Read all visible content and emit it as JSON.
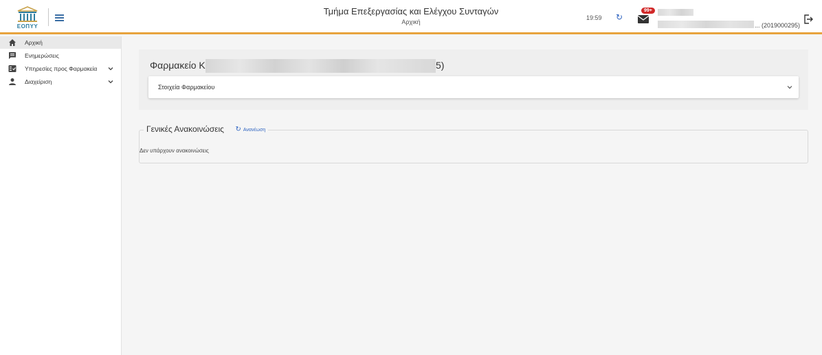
{
  "header": {
    "logo_text": "ΕΟΠΥΥ",
    "title": "Τμήμα Επεξεργασίας και Ελέγχου Συνταγών",
    "subtitle": "Αρχική",
    "time": "19:59",
    "badge": "99+",
    "user_id": "... (2019000295)"
  },
  "sidebar": {
    "items": [
      {
        "label": "Αρχική",
        "icon": "home-icon"
      },
      {
        "label": "Ενημερώσεις",
        "icon": "message-icon"
      },
      {
        "label": "Υπηρεσίες προς Φαρμακεία",
        "icon": "services-icon"
      },
      {
        "label": "Διαχείριση",
        "icon": "person-icon"
      }
    ]
  },
  "main": {
    "pharmacy_title_start": "Φαρμακείο Κ",
    "pharmacy_title_end": "5)",
    "pharmacy_details_label": "Στοιχεία Φαρμακείου",
    "announcements_title": "Γενικές Ανακοινώσεις",
    "refresh_label": "Ανανέωση",
    "no_announcements": "Δεν υπάρχουν ανακοινώσεις"
  },
  "colors": {
    "accent": "#e8a33d",
    "link": "#2f64c1",
    "badge": "#d12828"
  }
}
